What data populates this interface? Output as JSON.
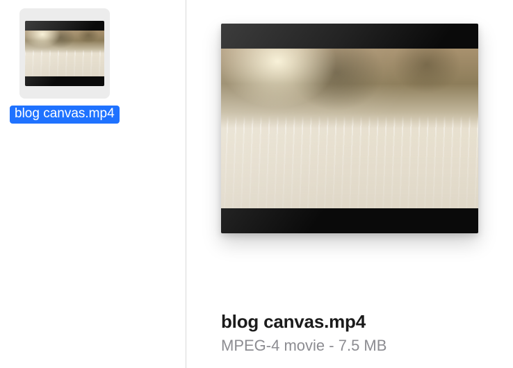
{
  "file": {
    "name": "blog canvas.mp4",
    "kind": "MPEG-4 movie",
    "size": "7.5 MB",
    "details_separator": " - "
  }
}
